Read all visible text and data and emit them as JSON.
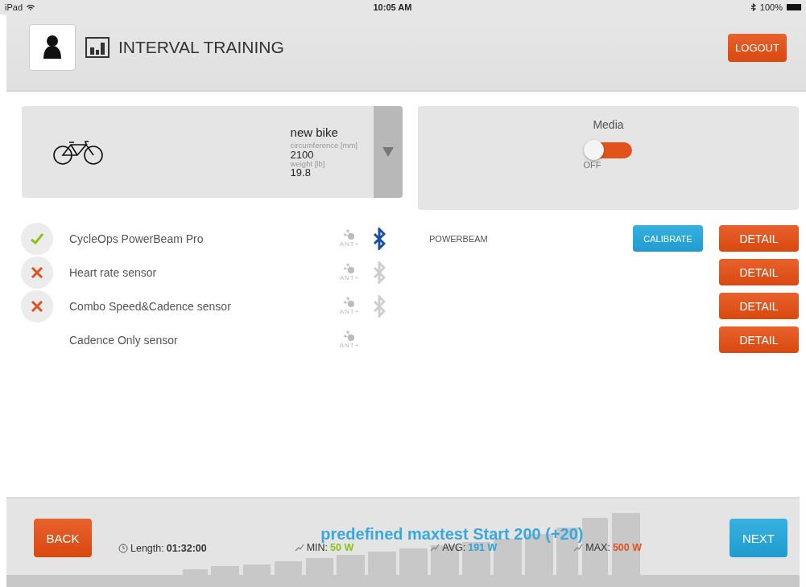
{
  "status_bar": {
    "device": "iPad",
    "time": "10:05 AM",
    "battery": "100%"
  },
  "header": {
    "title": "INTERVAL TRAINING",
    "logout": "LOGOUT"
  },
  "bike": {
    "name": "new bike",
    "circumference_label": "circumference [mm]",
    "circumference": "2100",
    "weight_label": "weight [lb]",
    "weight": "19.8"
  },
  "media": {
    "title": "Media",
    "on": false,
    "state_label": "OFF"
  },
  "sensors": [
    {
      "name": "CycleOps PowerBeam Pro",
      "kind": "check",
      "ant_label": "ANT+",
      "bluetooth_active": true,
      "device": "POWERBEAM",
      "calibrate": "CALIBRATE",
      "detail": "DETAIL"
    },
    {
      "name": "Heart rate sensor",
      "kind": "cross",
      "ant_label": "ANT+",
      "bluetooth_active": false,
      "detail": "DETAIL"
    },
    {
      "name": "Combo Speed&Cadence sensor",
      "kind": "cross",
      "ant_label": "ANT+",
      "bluetooth_active": false,
      "detail": "DETAIL"
    },
    {
      "name": "Cadence Only sensor",
      "kind": "plain",
      "ant_label": "ANT+",
      "detail": "DETAIL"
    }
  ],
  "footer": {
    "back": "BACK",
    "next": "NEXT",
    "program": "predefined maxtest Start 200 (+20)",
    "length_label": "Length:",
    "length": "01:32:00",
    "stats": [
      {
        "label": "MIN:",
        "value": "50 W",
        "color": "#8cc21a"
      },
      {
        "label": "AVG:",
        "value": "191 W",
        "color": "#2ea3d6"
      },
      {
        "label": "MAX:",
        "value": "500 W",
        "color": "#e2531c"
      }
    ]
  }
}
